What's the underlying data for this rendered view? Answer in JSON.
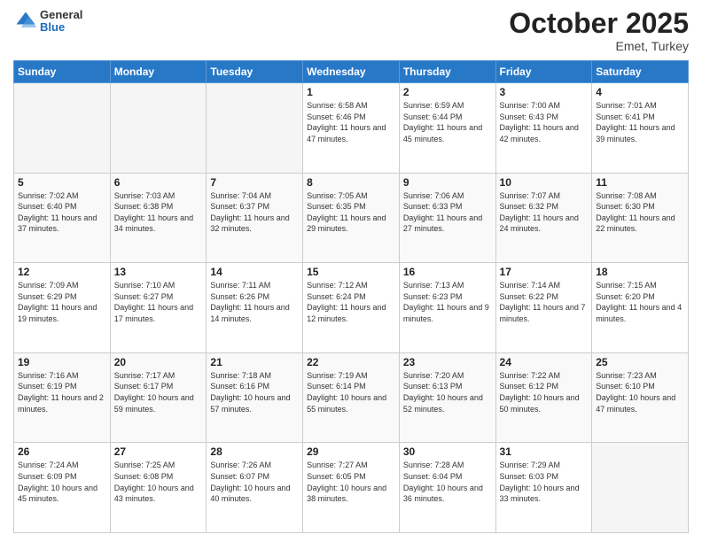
{
  "header": {
    "logo": {
      "general": "General",
      "blue": "Blue"
    },
    "title": "October 2025",
    "subtitle": "Emet, Turkey"
  },
  "days_of_week": [
    "Sunday",
    "Monday",
    "Tuesday",
    "Wednesday",
    "Thursday",
    "Friday",
    "Saturday"
  ],
  "weeks": [
    [
      {
        "day": "",
        "sunrise": "",
        "sunset": "",
        "daylight": ""
      },
      {
        "day": "",
        "sunrise": "",
        "sunset": "",
        "daylight": ""
      },
      {
        "day": "",
        "sunrise": "",
        "sunset": "",
        "daylight": ""
      },
      {
        "day": "1",
        "sunrise": "Sunrise: 6:58 AM",
        "sunset": "Sunset: 6:46 PM",
        "daylight": "Daylight: 11 hours and 47 minutes."
      },
      {
        "day": "2",
        "sunrise": "Sunrise: 6:59 AM",
        "sunset": "Sunset: 6:44 PM",
        "daylight": "Daylight: 11 hours and 45 minutes."
      },
      {
        "day": "3",
        "sunrise": "Sunrise: 7:00 AM",
        "sunset": "Sunset: 6:43 PM",
        "daylight": "Daylight: 11 hours and 42 minutes."
      },
      {
        "day": "4",
        "sunrise": "Sunrise: 7:01 AM",
        "sunset": "Sunset: 6:41 PM",
        "daylight": "Daylight: 11 hours and 39 minutes."
      }
    ],
    [
      {
        "day": "5",
        "sunrise": "Sunrise: 7:02 AM",
        "sunset": "Sunset: 6:40 PM",
        "daylight": "Daylight: 11 hours and 37 minutes."
      },
      {
        "day": "6",
        "sunrise": "Sunrise: 7:03 AM",
        "sunset": "Sunset: 6:38 PM",
        "daylight": "Daylight: 11 hours and 34 minutes."
      },
      {
        "day": "7",
        "sunrise": "Sunrise: 7:04 AM",
        "sunset": "Sunset: 6:37 PM",
        "daylight": "Daylight: 11 hours and 32 minutes."
      },
      {
        "day": "8",
        "sunrise": "Sunrise: 7:05 AM",
        "sunset": "Sunset: 6:35 PM",
        "daylight": "Daylight: 11 hours and 29 minutes."
      },
      {
        "day": "9",
        "sunrise": "Sunrise: 7:06 AM",
        "sunset": "Sunset: 6:33 PM",
        "daylight": "Daylight: 11 hours and 27 minutes."
      },
      {
        "day": "10",
        "sunrise": "Sunrise: 7:07 AM",
        "sunset": "Sunset: 6:32 PM",
        "daylight": "Daylight: 11 hours and 24 minutes."
      },
      {
        "day": "11",
        "sunrise": "Sunrise: 7:08 AM",
        "sunset": "Sunset: 6:30 PM",
        "daylight": "Daylight: 11 hours and 22 minutes."
      }
    ],
    [
      {
        "day": "12",
        "sunrise": "Sunrise: 7:09 AM",
        "sunset": "Sunset: 6:29 PM",
        "daylight": "Daylight: 11 hours and 19 minutes."
      },
      {
        "day": "13",
        "sunrise": "Sunrise: 7:10 AM",
        "sunset": "Sunset: 6:27 PM",
        "daylight": "Daylight: 11 hours and 17 minutes."
      },
      {
        "day": "14",
        "sunrise": "Sunrise: 7:11 AM",
        "sunset": "Sunset: 6:26 PM",
        "daylight": "Daylight: 11 hours and 14 minutes."
      },
      {
        "day": "15",
        "sunrise": "Sunrise: 7:12 AM",
        "sunset": "Sunset: 6:24 PM",
        "daylight": "Daylight: 11 hours and 12 minutes."
      },
      {
        "day": "16",
        "sunrise": "Sunrise: 7:13 AM",
        "sunset": "Sunset: 6:23 PM",
        "daylight": "Daylight: 11 hours and 9 minutes."
      },
      {
        "day": "17",
        "sunrise": "Sunrise: 7:14 AM",
        "sunset": "Sunset: 6:22 PM",
        "daylight": "Daylight: 11 hours and 7 minutes."
      },
      {
        "day": "18",
        "sunrise": "Sunrise: 7:15 AM",
        "sunset": "Sunset: 6:20 PM",
        "daylight": "Daylight: 11 hours and 4 minutes."
      }
    ],
    [
      {
        "day": "19",
        "sunrise": "Sunrise: 7:16 AM",
        "sunset": "Sunset: 6:19 PM",
        "daylight": "Daylight: 11 hours and 2 minutes."
      },
      {
        "day": "20",
        "sunrise": "Sunrise: 7:17 AM",
        "sunset": "Sunset: 6:17 PM",
        "daylight": "Daylight: 10 hours and 59 minutes."
      },
      {
        "day": "21",
        "sunrise": "Sunrise: 7:18 AM",
        "sunset": "Sunset: 6:16 PM",
        "daylight": "Daylight: 10 hours and 57 minutes."
      },
      {
        "day": "22",
        "sunrise": "Sunrise: 7:19 AM",
        "sunset": "Sunset: 6:14 PM",
        "daylight": "Daylight: 10 hours and 55 minutes."
      },
      {
        "day": "23",
        "sunrise": "Sunrise: 7:20 AM",
        "sunset": "Sunset: 6:13 PM",
        "daylight": "Daylight: 10 hours and 52 minutes."
      },
      {
        "day": "24",
        "sunrise": "Sunrise: 7:22 AM",
        "sunset": "Sunset: 6:12 PM",
        "daylight": "Daylight: 10 hours and 50 minutes."
      },
      {
        "day": "25",
        "sunrise": "Sunrise: 7:23 AM",
        "sunset": "Sunset: 6:10 PM",
        "daylight": "Daylight: 10 hours and 47 minutes."
      }
    ],
    [
      {
        "day": "26",
        "sunrise": "Sunrise: 7:24 AM",
        "sunset": "Sunset: 6:09 PM",
        "daylight": "Daylight: 10 hours and 45 minutes."
      },
      {
        "day": "27",
        "sunrise": "Sunrise: 7:25 AM",
        "sunset": "Sunset: 6:08 PM",
        "daylight": "Daylight: 10 hours and 43 minutes."
      },
      {
        "day": "28",
        "sunrise": "Sunrise: 7:26 AM",
        "sunset": "Sunset: 6:07 PM",
        "daylight": "Daylight: 10 hours and 40 minutes."
      },
      {
        "day": "29",
        "sunrise": "Sunrise: 7:27 AM",
        "sunset": "Sunset: 6:05 PM",
        "daylight": "Daylight: 10 hours and 38 minutes."
      },
      {
        "day": "30",
        "sunrise": "Sunrise: 7:28 AM",
        "sunset": "Sunset: 6:04 PM",
        "daylight": "Daylight: 10 hours and 36 minutes."
      },
      {
        "day": "31",
        "sunrise": "Sunrise: 7:29 AM",
        "sunset": "Sunset: 6:03 PM",
        "daylight": "Daylight: 10 hours and 33 minutes."
      },
      {
        "day": "",
        "sunrise": "",
        "sunset": "",
        "daylight": ""
      }
    ]
  ]
}
